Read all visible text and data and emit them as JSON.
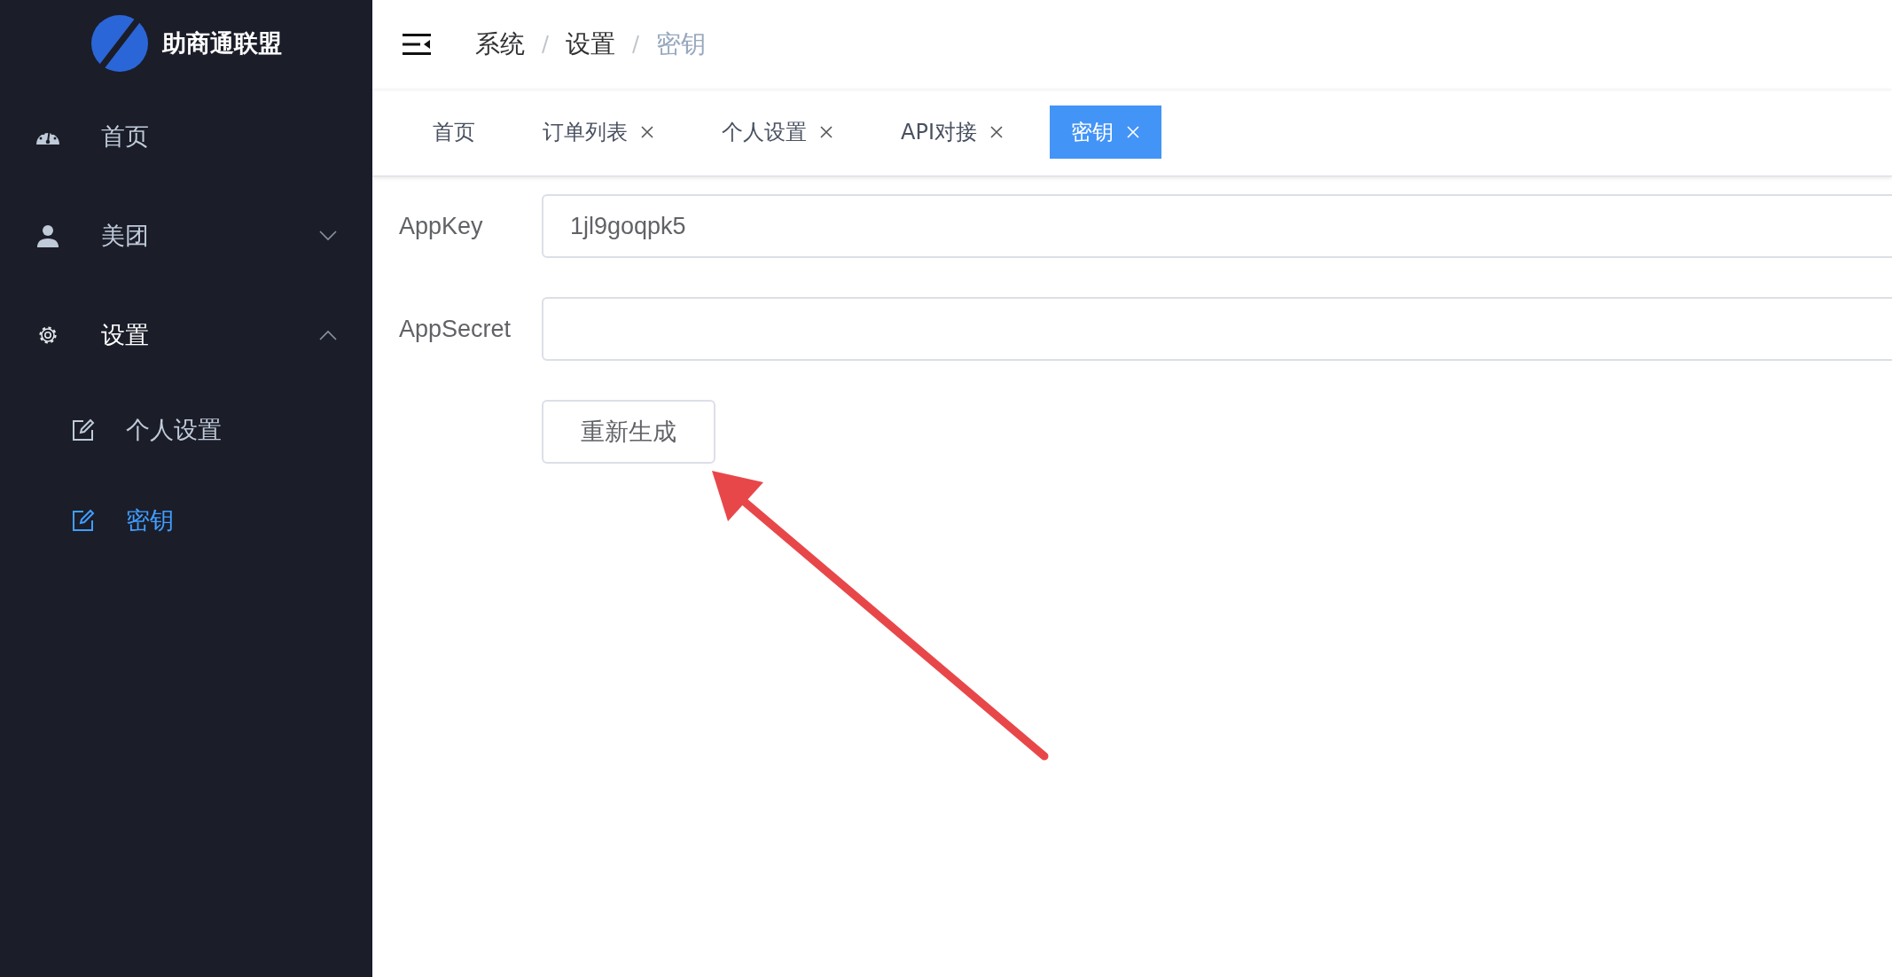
{
  "app": {
    "name": "助商通联盟"
  },
  "sidebar": {
    "items": [
      {
        "label": "首页",
        "kind": "link",
        "selected": false
      },
      {
        "label": "美团",
        "kind": "group",
        "expanded": false
      },
      {
        "label": "设置",
        "kind": "group",
        "expanded": true,
        "children": [
          {
            "label": "个人设置",
            "selected": false
          },
          {
            "label": "密钥",
            "selected": true
          }
        ]
      }
    ]
  },
  "breadcrumb": [
    "系统",
    "设置",
    "密钥"
  ],
  "tabs": [
    {
      "label": "首页",
      "closable": false,
      "selected": false
    },
    {
      "label": "订单列表",
      "closable": true,
      "selected": false
    },
    {
      "label": "个人设置",
      "closable": true,
      "selected": false
    },
    {
      "label": "API对接",
      "closable": true,
      "selected": false
    },
    {
      "label": "密钥",
      "closable": true,
      "selected": true
    }
  ],
  "form": {
    "fields": [
      {
        "label": "AppKey",
        "value": "1jl9goqpk5"
      },
      {
        "label": "AppSecret"
      }
    ],
    "button": "重新生成"
  }
}
